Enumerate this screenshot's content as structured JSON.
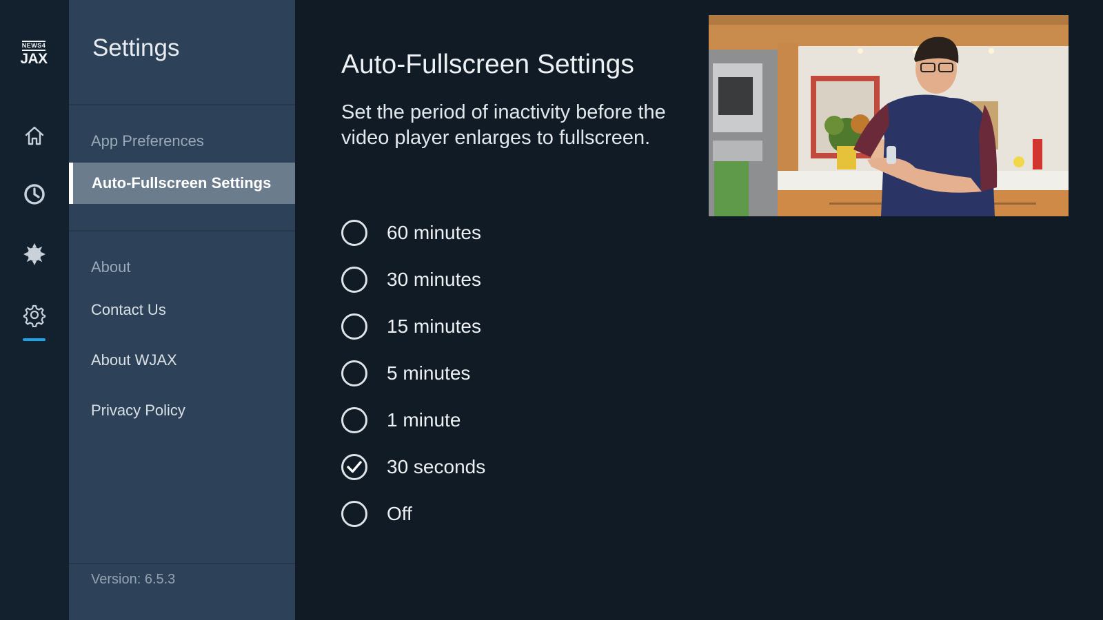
{
  "logo": {
    "top_text": "NEWS4",
    "bottom_text": "JAX"
  },
  "rail": {
    "items": [
      {
        "icon": "home-icon"
      },
      {
        "icon": "clock-icon"
      },
      {
        "icon": "sun-icon"
      },
      {
        "icon": "gear-icon",
        "active": true
      }
    ],
    "accent_color": "#1ba3e8"
  },
  "panel": {
    "title": "Settings",
    "section1": {
      "label": "App Preferences",
      "items": [
        {
          "label": "Auto-Fullscreen Settings",
          "selected": true
        }
      ]
    },
    "section2": {
      "label": "About",
      "items": [
        {
          "label": "Contact Us"
        },
        {
          "label": "About WJAX"
        },
        {
          "label": "Privacy Policy"
        }
      ]
    },
    "version": "Version: 6.5.3"
  },
  "main": {
    "title": "Auto-Fullscreen Settings",
    "description": "Set the period of inactivity before the video player enlarges to fullscreen.",
    "options": [
      {
        "label": "60 minutes",
        "checked": false
      },
      {
        "label": "30 minutes",
        "checked": false
      },
      {
        "label": "15 minutes",
        "checked": false
      },
      {
        "label": "5 minutes",
        "checked": false
      },
      {
        "label": "1 minute",
        "checked": false
      },
      {
        "label": "30 seconds",
        "checked": true
      },
      {
        "label": "Off",
        "checked": false
      }
    ]
  },
  "colors": {
    "background": "#101b25",
    "rail": "#13212f",
    "panel": "#2d4258",
    "selected_item": "#6b7c8c"
  }
}
